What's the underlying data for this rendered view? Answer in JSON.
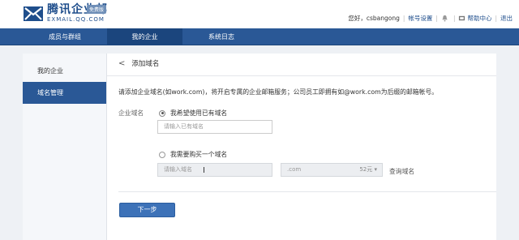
{
  "header": {
    "logo_cn": "腾讯企业邮",
    "logo_en": "EXMAIL.QQ.COM",
    "badge": "免费版",
    "greeting": "您好，csbangong",
    "account_settings": "帐号设置",
    "help_center": "帮助中心",
    "logout": "退出"
  },
  "nav": {
    "items": [
      {
        "label": "成员与群组"
      },
      {
        "label": "我的企业"
      },
      {
        "label": "系统日志"
      }
    ]
  },
  "sidebar": {
    "items": [
      {
        "label": "我的企业"
      },
      {
        "label": "域名管理"
      }
    ]
  },
  "main": {
    "title": "添加域名",
    "description": "请添加企业域名(如work.com)，将开启专属的企业邮箱服务；公司员工即拥有如@work.com为后缀的邮箱帐号。",
    "field_label": "企业域名",
    "option_existing": "我希望使用已有域名",
    "existing_placeholder": "请输入已有域名",
    "option_buy": "我需要购买一个域名",
    "buy_placeholder": "请输入域名",
    "tld_value": ".com",
    "tld_price": "52元",
    "query_link": "查询域名",
    "next_button": "下一步"
  },
  "colors": {
    "nav_bg": "#2a5896",
    "brand": "#1f4e8c",
    "primary_button": "#3d72b8"
  }
}
